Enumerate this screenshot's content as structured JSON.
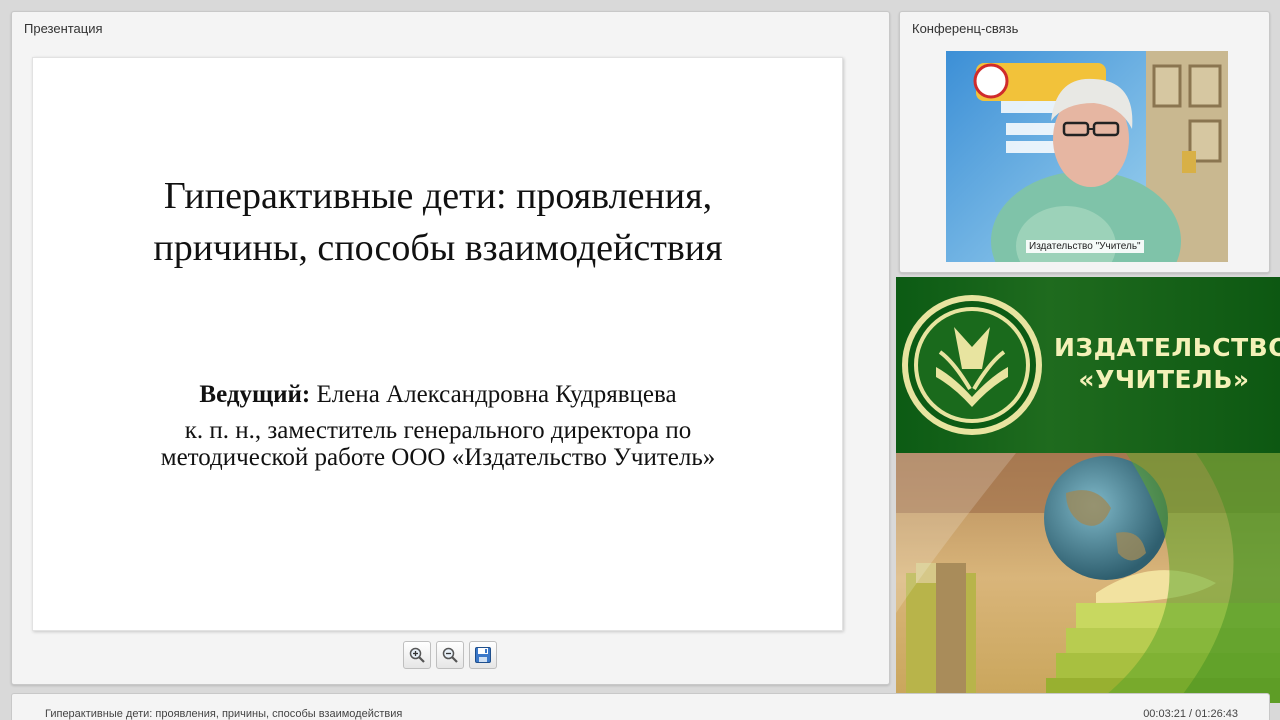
{
  "presentation": {
    "panel_title": "Презентация",
    "slide": {
      "title": "Гиперактивные дети: проявления, причины, способы взаимодействия",
      "presenter_label": "Ведущий:",
      "presenter_name": "Елена Александровна Кудрявцева",
      "presenter_description": "к. п. н., заместитель генерального директора по методической работе ООО «Издательство Учитель»"
    },
    "toolbar": [
      {
        "name": "zoom-in-button",
        "icon": "zoom-in-icon"
      },
      {
        "name": "zoom-out-button",
        "icon": "zoom-out-icon"
      },
      {
        "name": "save-button",
        "icon": "floppy-disk-icon"
      }
    ]
  },
  "conference": {
    "panel_title": "Конференц-связь",
    "video_caption": "Издательство \"Учитель\""
  },
  "brand": {
    "line1": "ИЗДАТЕЛЬСТВО",
    "line2": "«УЧИТЕЛЬ»",
    "colors": {
      "green": "#0c5b14",
      "text": "#f4f1b8"
    }
  },
  "footer": {
    "title": "Гиперактивные дети: проявления, причины, способы взаимодействия",
    "time": "00:03:21 / 01:26:43"
  }
}
